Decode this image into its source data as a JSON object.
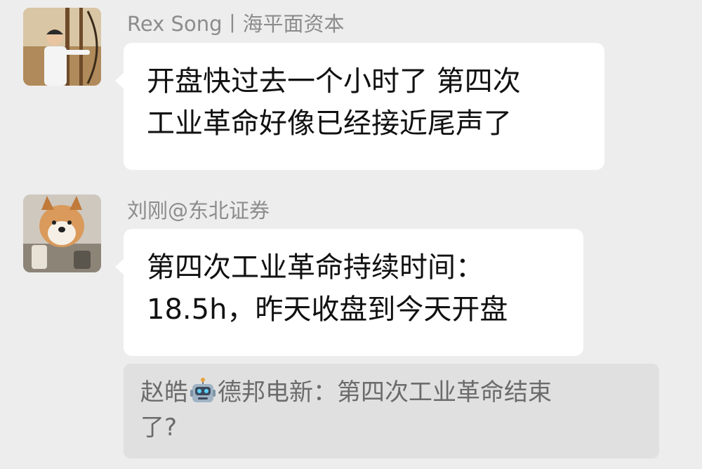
{
  "messages": [
    {
      "sender": "Rex Song丨海平面资本",
      "lines": [
        "开盘快过去一个小时了 第四次",
        "工业革命好像已经接近尾声了"
      ]
    },
    {
      "sender": "刘刚@东北证券",
      "lines": [
        "第四次工业革命持续时间：",
        "18.5h，昨天收盘到今天开盘"
      ]
    }
  ],
  "quote": {
    "author_prefix": "赵皓",
    "author_suffix": "德邦电新：",
    "text_line1": "第四次工业革命结束",
    "text_line2": "了?",
    "emoji": "robot-face-emoji"
  },
  "colors": {
    "background": "#ededed",
    "bubble": "#ffffff",
    "quote_background": "#e0e0e0",
    "sender_text": "#8c8c8c",
    "message_text": "#111111",
    "quote_text": "#6b6b6b"
  }
}
